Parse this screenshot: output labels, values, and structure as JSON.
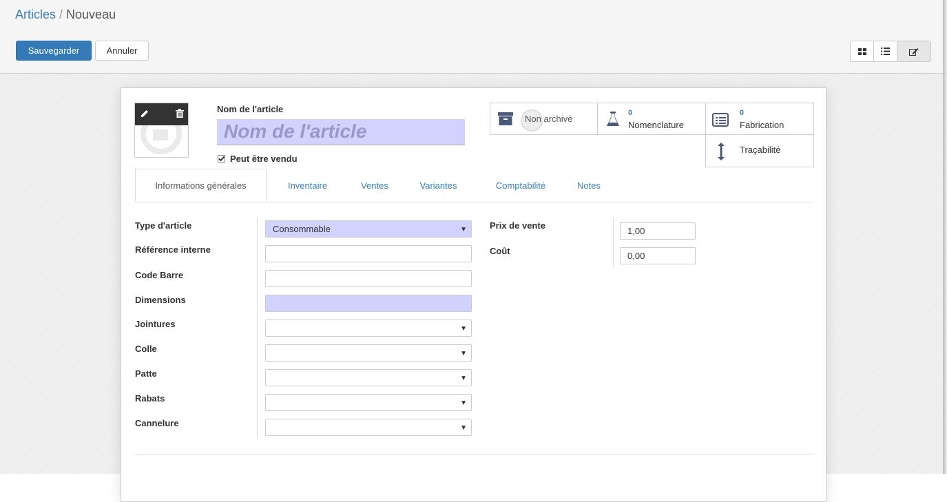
{
  "breadcrumb": {
    "parent": "Articles",
    "separator": "/",
    "current": "Nouveau"
  },
  "toolbar": {
    "save_label": "Sauvegarder",
    "cancel_label": "Annuler"
  },
  "view_switcher": [
    "kanban-view",
    "list-view",
    "form-view"
  ],
  "product": {
    "name_label": "Nom de l'article",
    "name_placeholder": "Nom de l'article",
    "sale_ok_label": "Peut être vendu",
    "sale_ok_checked": true
  },
  "smart_buttons": {
    "archive": {
      "label": "Non archivé"
    },
    "bom": {
      "count": "0",
      "label": "Nomenclature"
    },
    "manufacturing": {
      "count": "0",
      "label": "Fabrication"
    },
    "traceability": {
      "label": "Traçabilité"
    }
  },
  "tabs": [
    "Informations générales",
    "Inventaire",
    "Ventes",
    "Variantes",
    "Comptabilité",
    "Notes"
  ],
  "fields_left": [
    {
      "label": "Type d'article",
      "value": "Consommable"
    },
    {
      "label": "Référence interne",
      "value": ""
    },
    {
      "label": "Code Barre",
      "value": ""
    },
    {
      "label": "Dimensions",
      "value": ""
    },
    {
      "label": "Jointures",
      "value": ""
    },
    {
      "label": "Colle",
      "value": ""
    },
    {
      "label": "Patte",
      "value": ""
    },
    {
      "label": "Rabats",
      "value": ""
    },
    {
      "label": "Cannelure",
      "value": ""
    }
  ],
  "fields_right": [
    {
      "label": "Prix de vente",
      "value": "1,00"
    },
    {
      "label": "Coût",
      "value": "0,00"
    }
  ],
  "colors": {
    "primary": "#337ab7",
    "link": "#3b7fb6",
    "required_bg": "#d2d2ff"
  }
}
